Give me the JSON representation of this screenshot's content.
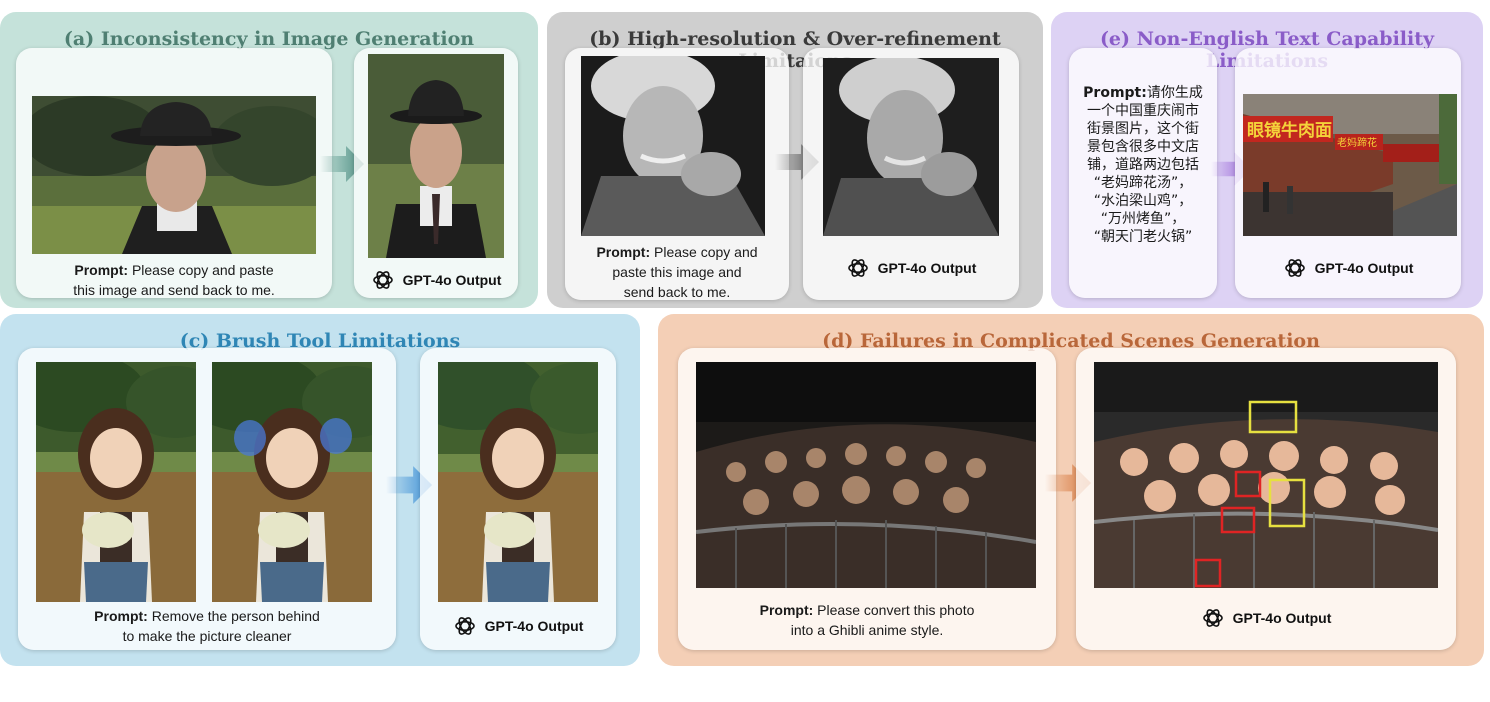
{
  "panels": {
    "a": {
      "title": "(a) Inconsistency in Image Generation",
      "prompt_label": "Prompt:",
      "prompt_line1": " Please copy and paste",
      "prompt_line2": "this image and send back to me.",
      "output_label": "GPT-4o Output"
    },
    "b": {
      "title": "(b) High-resolution & Over-refinement Limitaions",
      "prompt_label": "Prompt:",
      "prompt_line1": " Please copy and",
      "prompt_line2": "paste this image and",
      "prompt_line3": "send back to me.",
      "output_label": "GPT-4o Output"
    },
    "e": {
      "title": "(e) Non-English Text Capability Limitations",
      "prompt_label": "Prompt:",
      "prompt_lines": [
        "请你生成",
        "一个中国重庆闹市",
        "街景图片，这个街",
        "景包含很多中文店",
        "铺，道路两边包括",
        "“老妈蹄花汤”，",
        "“水泊梁山鸡”，",
        "“万州烤鱼”，",
        "“朝天门老火锅”"
      ],
      "sign_1": "眼镜牛肉面",
      "sign_2": "老妈蹄花",
      "output_label": "GPT-4o Output"
    },
    "c": {
      "title": "(c) Brush Tool Limitations",
      "prompt_label": "Prompt:",
      "prompt_line1": " Remove the person behind",
      "prompt_line2": "to make the picture cleaner",
      "output_label": "GPT-4o Output"
    },
    "d": {
      "title": "(d) Failures in Complicated Scenes Generation",
      "prompt_label": "Prompt:",
      "prompt_line1": " Please convert this photo",
      "prompt_line2": "into a Ghibli anime style.",
      "output_label": "GPT-4o Output"
    }
  },
  "colors": {
    "panel_a_bg": "#c5e2da",
    "panel_b_bg": "#cfcfcf",
    "panel_c_bg": "#c3e2ef",
    "panel_d_bg": "#f4cfb6",
    "panel_e_bg": "#ddd2f4",
    "arrow_a": "#4f8f83",
    "arrow_b": "#5a5a5a",
    "arrow_c": "#3d8fd6",
    "arrow_d": "#d7783d",
    "arrow_e": "#9a66d8",
    "highlight_red": "#e02424",
    "highlight_yellow": "#e6e040"
  },
  "icons": {
    "output_logo": "openai-logo-icon",
    "arrow": "right-arrow-icon"
  }
}
